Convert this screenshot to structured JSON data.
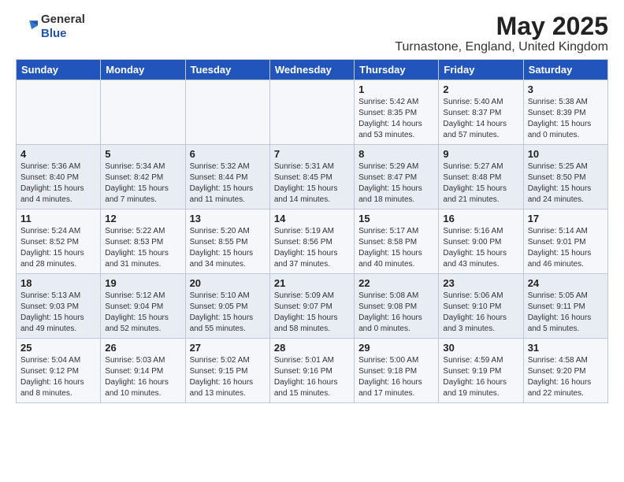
{
  "logo": {
    "general": "General",
    "blue": "Blue"
  },
  "header": {
    "month_year": "May 2025",
    "location": "Turnastone, England, United Kingdom"
  },
  "weekdays": [
    "Sunday",
    "Monday",
    "Tuesday",
    "Wednesday",
    "Thursday",
    "Friday",
    "Saturday"
  ],
  "weeks": [
    [
      {
        "day": "",
        "content": ""
      },
      {
        "day": "",
        "content": ""
      },
      {
        "day": "",
        "content": ""
      },
      {
        "day": "",
        "content": ""
      },
      {
        "day": "1",
        "content": "Sunrise: 5:42 AM\nSunset: 8:35 PM\nDaylight: 14 hours\nand 53 minutes."
      },
      {
        "day": "2",
        "content": "Sunrise: 5:40 AM\nSunset: 8:37 PM\nDaylight: 14 hours\nand 57 minutes."
      },
      {
        "day": "3",
        "content": "Sunrise: 5:38 AM\nSunset: 8:39 PM\nDaylight: 15 hours\nand 0 minutes."
      }
    ],
    [
      {
        "day": "4",
        "content": "Sunrise: 5:36 AM\nSunset: 8:40 PM\nDaylight: 15 hours\nand 4 minutes."
      },
      {
        "day": "5",
        "content": "Sunrise: 5:34 AM\nSunset: 8:42 PM\nDaylight: 15 hours\nand 7 minutes."
      },
      {
        "day": "6",
        "content": "Sunrise: 5:32 AM\nSunset: 8:44 PM\nDaylight: 15 hours\nand 11 minutes."
      },
      {
        "day": "7",
        "content": "Sunrise: 5:31 AM\nSunset: 8:45 PM\nDaylight: 15 hours\nand 14 minutes."
      },
      {
        "day": "8",
        "content": "Sunrise: 5:29 AM\nSunset: 8:47 PM\nDaylight: 15 hours\nand 18 minutes."
      },
      {
        "day": "9",
        "content": "Sunrise: 5:27 AM\nSunset: 8:48 PM\nDaylight: 15 hours\nand 21 minutes."
      },
      {
        "day": "10",
        "content": "Sunrise: 5:25 AM\nSunset: 8:50 PM\nDaylight: 15 hours\nand 24 minutes."
      }
    ],
    [
      {
        "day": "11",
        "content": "Sunrise: 5:24 AM\nSunset: 8:52 PM\nDaylight: 15 hours\nand 28 minutes."
      },
      {
        "day": "12",
        "content": "Sunrise: 5:22 AM\nSunset: 8:53 PM\nDaylight: 15 hours\nand 31 minutes."
      },
      {
        "day": "13",
        "content": "Sunrise: 5:20 AM\nSunset: 8:55 PM\nDaylight: 15 hours\nand 34 minutes."
      },
      {
        "day": "14",
        "content": "Sunrise: 5:19 AM\nSunset: 8:56 PM\nDaylight: 15 hours\nand 37 minutes."
      },
      {
        "day": "15",
        "content": "Sunrise: 5:17 AM\nSunset: 8:58 PM\nDaylight: 15 hours\nand 40 minutes."
      },
      {
        "day": "16",
        "content": "Sunrise: 5:16 AM\nSunset: 9:00 PM\nDaylight: 15 hours\nand 43 minutes."
      },
      {
        "day": "17",
        "content": "Sunrise: 5:14 AM\nSunset: 9:01 PM\nDaylight: 15 hours\nand 46 minutes."
      }
    ],
    [
      {
        "day": "18",
        "content": "Sunrise: 5:13 AM\nSunset: 9:03 PM\nDaylight: 15 hours\nand 49 minutes."
      },
      {
        "day": "19",
        "content": "Sunrise: 5:12 AM\nSunset: 9:04 PM\nDaylight: 15 hours\nand 52 minutes."
      },
      {
        "day": "20",
        "content": "Sunrise: 5:10 AM\nSunset: 9:05 PM\nDaylight: 15 hours\nand 55 minutes."
      },
      {
        "day": "21",
        "content": "Sunrise: 5:09 AM\nSunset: 9:07 PM\nDaylight: 15 hours\nand 58 minutes."
      },
      {
        "day": "22",
        "content": "Sunrise: 5:08 AM\nSunset: 9:08 PM\nDaylight: 16 hours\nand 0 minutes."
      },
      {
        "day": "23",
        "content": "Sunrise: 5:06 AM\nSunset: 9:10 PM\nDaylight: 16 hours\nand 3 minutes."
      },
      {
        "day": "24",
        "content": "Sunrise: 5:05 AM\nSunset: 9:11 PM\nDaylight: 16 hours\nand 5 minutes."
      }
    ],
    [
      {
        "day": "25",
        "content": "Sunrise: 5:04 AM\nSunset: 9:12 PM\nDaylight: 16 hours\nand 8 minutes."
      },
      {
        "day": "26",
        "content": "Sunrise: 5:03 AM\nSunset: 9:14 PM\nDaylight: 16 hours\nand 10 minutes."
      },
      {
        "day": "27",
        "content": "Sunrise: 5:02 AM\nSunset: 9:15 PM\nDaylight: 16 hours\nand 13 minutes."
      },
      {
        "day": "28",
        "content": "Sunrise: 5:01 AM\nSunset: 9:16 PM\nDaylight: 16 hours\nand 15 minutes."
      },
      {
        "day": "29",
        "content": "Sunrise: 5:00 AM\nSunset: 9:18 PM\nDaylight: 16 hours\nand 17 minutes."
      },
      {
        "day": "30",
        "content": "Sunrise: 4:59 AM\nSunset: 9:19 PM\nDaylight: 16 hours\nand 19 minutes."
      },
      {
        "day": "31",
        "content": "Sunrise: 4:58 AM\nSunset: 9:20 PM\nDaylight: 16 hours\nand 22 minutes."
      }
    ]
  ]
}
